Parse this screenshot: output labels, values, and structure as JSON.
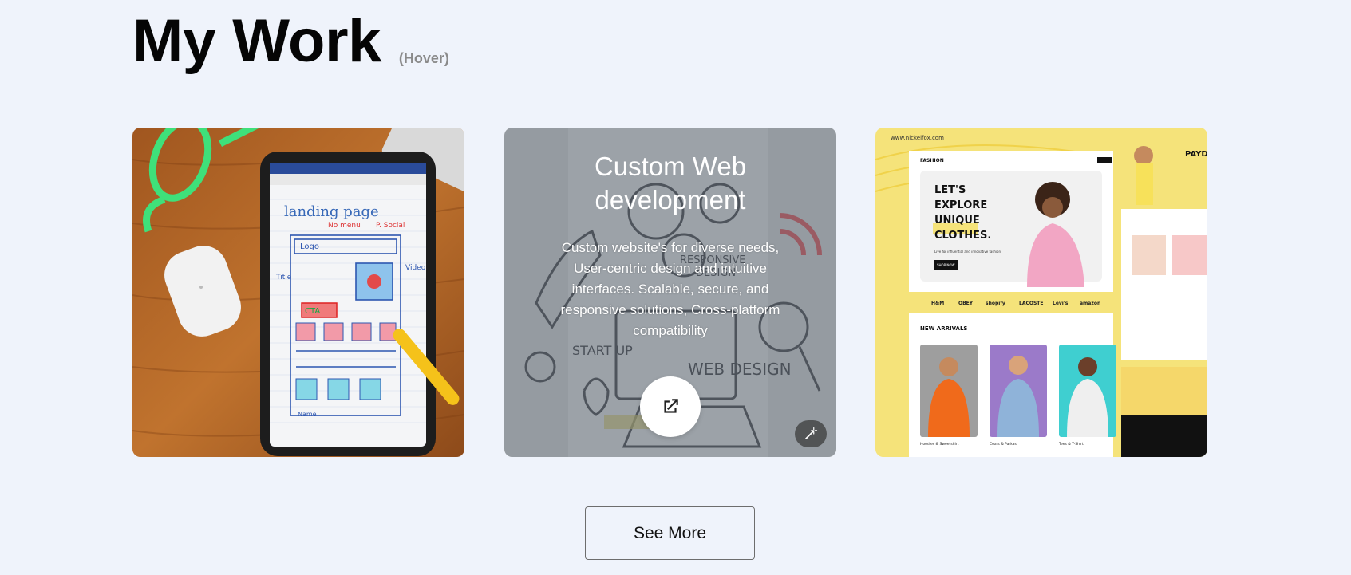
{
  "header": {
    "title": "My Work",
    "hint": "(Hover)"
  },
  "cards": [
    {
      "name": "landing-page-sketch",
      "image_texts": [
        "landing page",
        "No menu",
        "P. Social",
        "Logo",
        "Title",
        "Video",
        "CTA",
        "Name"
      ]
    },
    {
      "name": "custom-web-development",
      "overlay_title": "Custom Web development",
      "overlay_description": "Custom website's for diverse needs, User-centric design and intuitive interfaces. Scalable, secure, and responsive solutions, Cross-platform compatibility",
      "open_icon": "external-link-icon",
      "badge_icon": "magic-wand-icon",
      "image_texts": [
        "RESPONSIVE DESIGN",
        "START UP",
        "WEB DESIGN"
      ]
    },
    {
      "name": "fashion-ecommerce",
      "image_texts": {
        "url": "www.nickelfox.com",
        "logo": "FASHION",
        "headline": [
          "LET'S",
          "EXPLORE",
          "UNIQUE",
          "CLOTHES."
        ],
        "subline": "Live for influential and innovative fashion!",
        "cta": "SHOP NOW",
        "brands": [
          "H&M",
          "OBEY",
          "shopify",
          "LACOSTE",
          "Levi's",
          "amazon"
        ],
        "section": "NEW ARRIVALS",
        "products": [
          "Hoodies & Sweetshirt",
          "Coats & Parkas",
          "Tees & T-Shirt"
        ],
        "side": "PAYDAY SALE NOW"
      }
    }
  ],
  "see_more_label": "See More",
  "colors": {
    "background": "#eff3fb",
    "title": "#050505",
    "hint": "#8a8a8a",
    "fashion_yellow": "#f5e37a"
  }
}
